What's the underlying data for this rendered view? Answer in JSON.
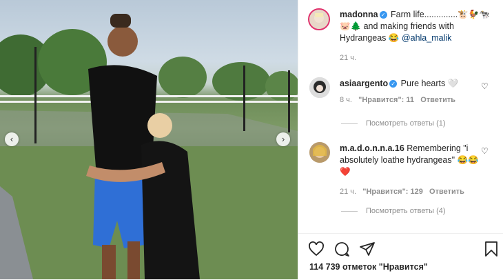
{
  "post": {
    "author": "madonna",
    "caption_text": "Farm life..............🐮🐓🐄🐷🌲 and making friends with Hydrangeas 😂",
    "caption_mention": "@ahla_malik",
    "time": "21 ч."
  },
  "comments": [
    {
      "author": "asiaargento",
      "text": "Pure hearts 🤍",
      "time": "8 ч.",
      "likes": "\"Нравится\": 11",
      "reply": "Ответить",
      "view_replies": "Посмотреть ответы (1)"
    },
    {
      "author": "m.a.d.o.n.n.a.16",
      "text": "Remembering \"i absolutely loathe hydrangeas\" 😂😂❤️",
      "time": "21 ч.",
      "likes": "\"Нравится\": 129",
      "reply": "Ответить",
      "view_replies": "Посмотреть ответы (4)"
    }
  ],
  "likes_count": "114 739 отметок \"Нравится\"",
  "icons": [
    "heart-icon",
    "comment-icon",
    "share-icon",
    "bookmark-icon",
    "chevron-left-icon",
    "chevron-right-icon",
    "verified-icon"
  ],
  "colors": {
    "verified": "#3897f0",
    "mention": "#00376b",
    "meta": "#8e8e8e"
  }
}
